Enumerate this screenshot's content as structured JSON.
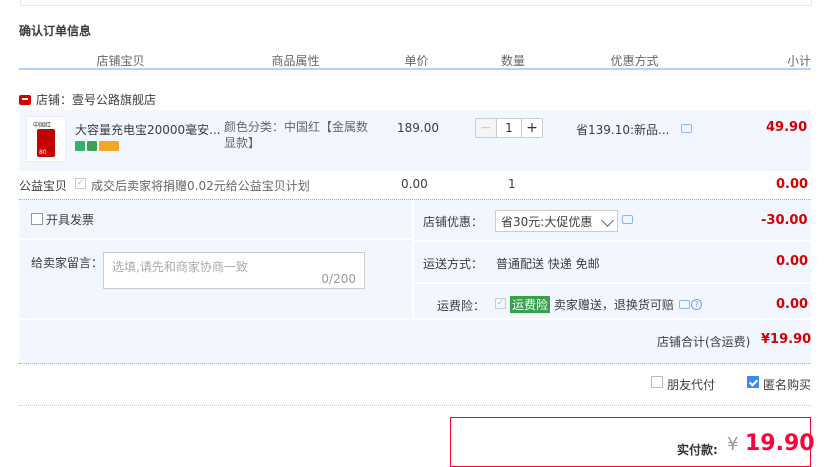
{
  "section_title": "确认订单信息",
  "columns": [
    "店铺宝贝",
    "商品属性",
    "单价",
    "数量",
    "优惠方式",
    "小计"
  ],
  "shop": {
    "name": "店铺：壹号公路旗舰店"
  },
  "item": {
    "title": "大容量充电宝20000毫安...",
    "thumb_brand": "中国红",
    "thumb_num": "80",
    "attribute": "颜色分类：中国红【金属数显款】",
    "price": "189.00",
    "quantity": "1",
    "discount": "省139.10:新品...",
    "subtotal": "49.90"
  },
  "charity": {
    "label": "公益宝贝",
    "text": "成交后卖家将捐赠0.02元给公益宝贝计划",
    "price": "0.00",
    "qty": "1",
    "subtotal": "0.00"
  },
  "invoice": {
    "label": "开具发票"
  },
  "memo": {
    "label": "给卖家留言：",
    "placeholder": "选填,请先和商家协商一致",
    "count": "0/200"
  },
  "shop_discount": {
    "label": "店铺优惠：",
    "selected": "省30元:大促优惠",
    "amount": "-30.00"
  },
  "shipping": {
    "label": "运送方式：",
    "value": "普通配送 快递 免邮",
    "amount": "0.00"
  },
  "insurance": {
    "label": "运费险：",
    "badge": "运费险",
    "text": "卖家赠送，退换货可赔",
    "amount": "0.00"
  },
  "shop_total": {
    "label": "店铺合计(含运费)",
    "amount": "¥19.90"
  },
  "options": {
    "friend_pay": "朋友代付",
    "anonymous": "匿名购买"
  },
  "payment": {
    "label": "实付款:",
    "currency": "¥",
    "amount": "19.90"
  },
  "colors": {
    "accent_red": "#d40000",
    "pay_red": "#ff0036",
    "panel_bg": "#f2f7ff",
    "header_line": "#b2d1ff"
  }
}
